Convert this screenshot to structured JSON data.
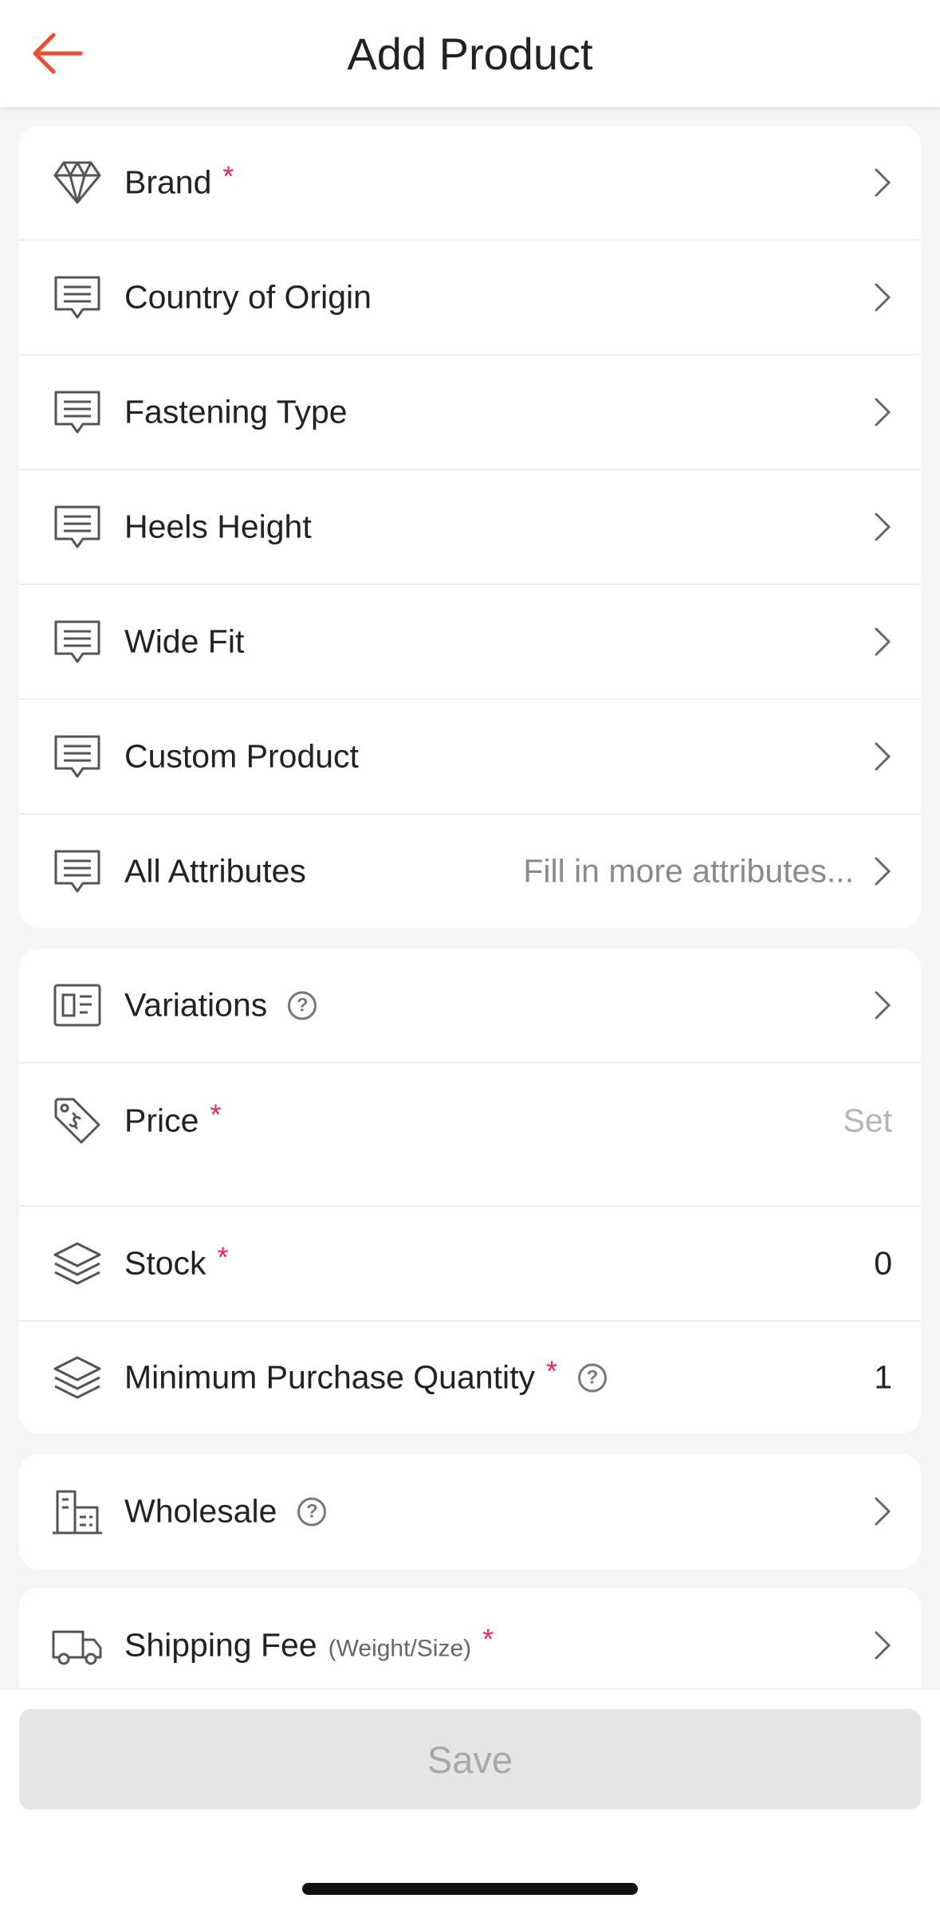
{
  "header": {
    "title": "Add Product",
    "back_icon": "arrow-left-icon",
    "accent_color": "#ee4d2d"
  },
  "attributes_card": {
    "items": [
      {
        "label": "Brand",
        "required": "*",
        "icon": "diamond-icon"
      },
      {
        "label": "Country of Origin",
        "icon": "message-icon"
      },
      {
        "label": "Fastening Type",
        "icon": "message-icon"
      },
      {
        "label": "Heels Height",
        "icon": "message-icon"
      },
      {
        "label": "Wide Fit",
        "icon": "message-icon"
      },
      {
        "label": "Custom Product",
        "icon": "message-icon"
      },
      {
        "label": "All Attributes",
        "hint": "Fill in more attributes...",
        "icon": "message-icon"
      }
    ]
  },
  "sales_card": {
    "variations": {
      "label": "Variations",
      "help": "?",
      "icon": "variations-icon"
    },
    "price": {
      "label": "Price",
      "required": "*",
      "value": "Set",
      "icon": "price-tag-icon"
    },
    "stock": {
      "label": "Stock",
      "required": "*",
      "value": "0",
      "icon": "layers-icon"
    },
    "min_qty": {
      "label": "Minimum Purchase Quantity",
      "required": "*",
      "help": "?",
      "value": "1",
      "icon": "layers-icon"
    }
  },
  "wholesale_card": {
    "label": "Wholesale",
    "help": "?",
    "icon": "building-icon"
  },
  "shipping_card": {
    "label": "Shipping Fee",
    "sublabel": "(Weight/Size)",
    "required": "*",
    "icon": "truck-icon"
  },
  "footer": {
    "save_label": "Save"
  }
}
